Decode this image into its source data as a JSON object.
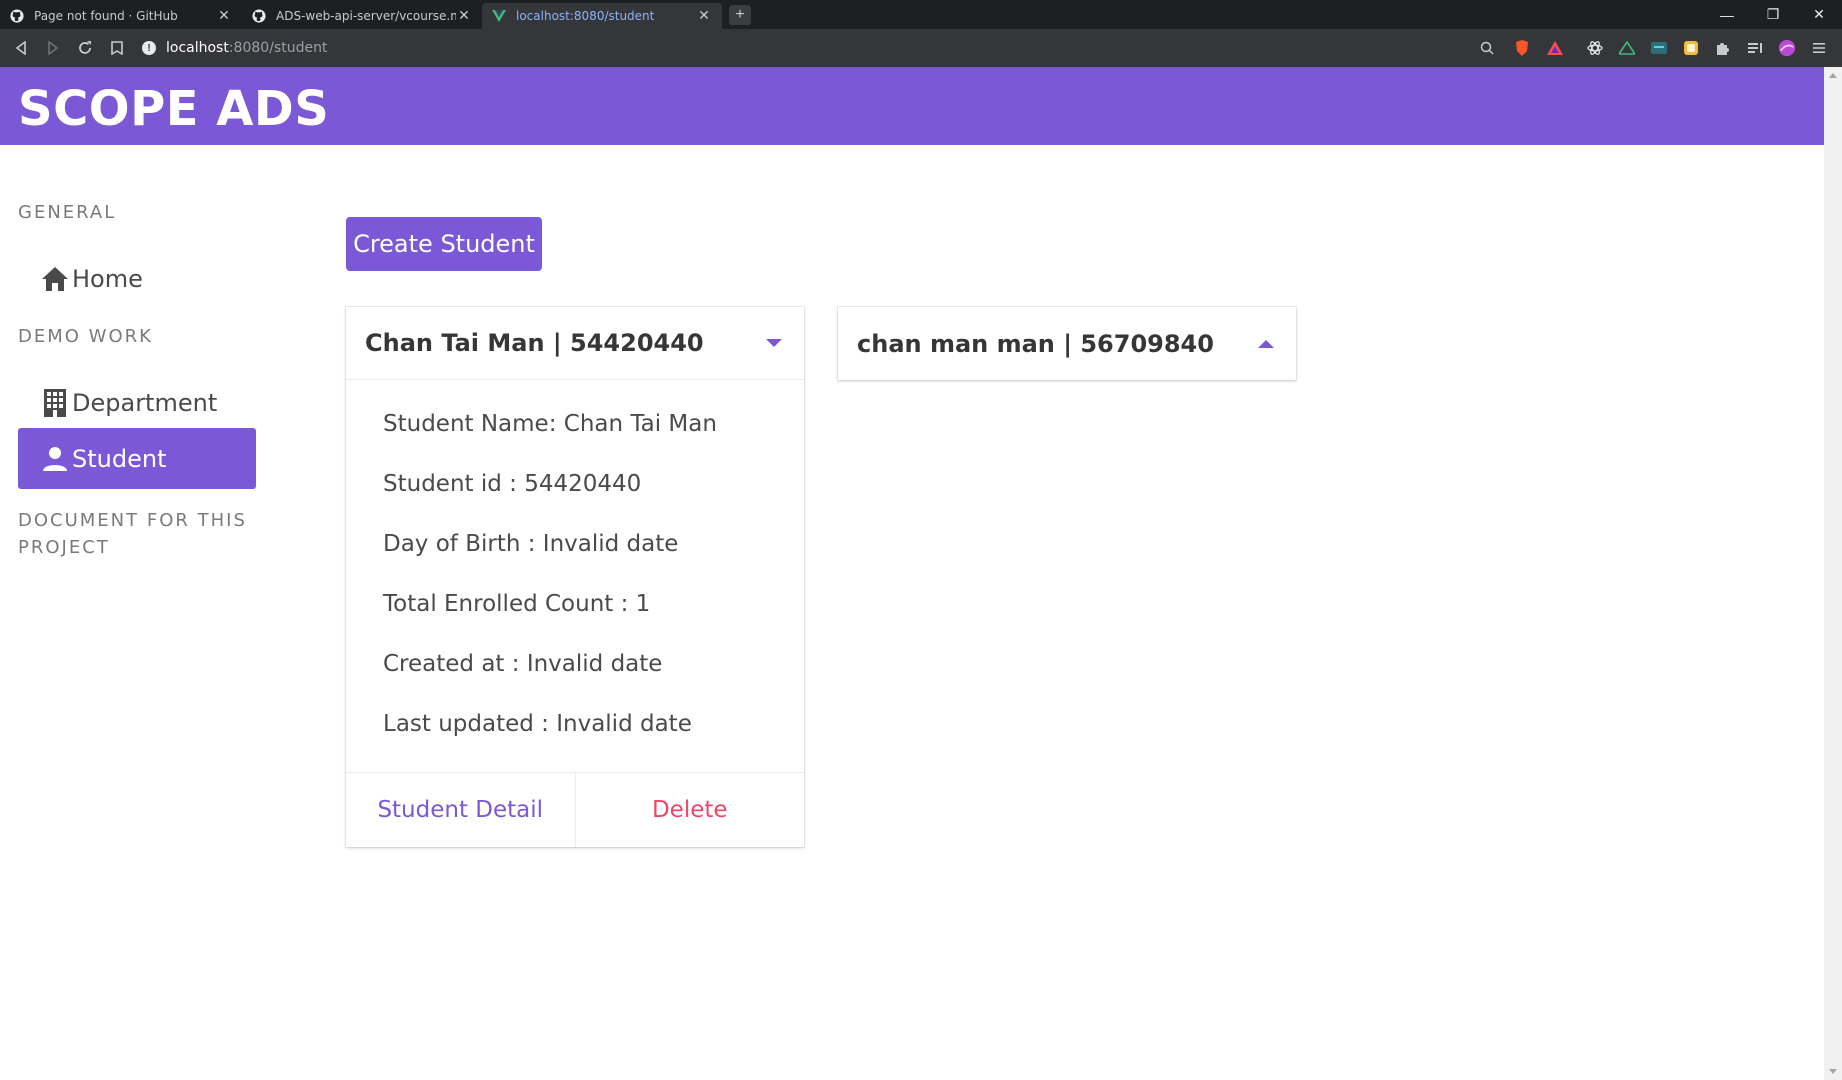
{
  "browser": {
    "tabs": [
      {
        "title": "Page not found · GitHub",
        "active": false
      },
      {
        "title": "ADS-web-api-server/vcourse.md a",
        "active": false
      },
      {
        "title": "localhost:8080/student",
        "active": true
      }
    ],
    "url_host": "localhost",
    "url_path": ":8080/student",
    "close_glyph": "✕",
    "new_tab_glyph": "+",
    "window_controls": {
      "minimize": "—",
      "restore": "❐",
      "close": "✕"
    }
  },
  "app": {
    "title": "SCOPE ADS",
    "accent_color": "#7b58d6",
    "danger_color": "#f14668"
  },
  "sidebar": {
    "general_label": "GENERAL",
    "home_label": "Home",
    "demo_label": "DEMO WORK",
    "department_label": "Department",
    "student_label": "Student",
    "document_label_line1": "DOCUMENT FOR THIS",
    "document_label_line2": "PROJECT"
  },
  "main": {
    "create_button": "Create Student",
    "cards": [
      {
        "header": "Chan Tai Man | 54420440",
        "expanded": true,
        "lines": [
          "Student Name: Chan Tai Man",
          "Student id : 54420440",
          "Day of Birth : Invalid date",
          "Total Enrolled Count : 1",
          "Created at : Invalid date",
          "Last updated : Invalid date"
        ],
        "detail_link": "Student Detail",
        "delete_link": "Delete"
      },
      {
        "header": "chan man man | 56709840",
        "expanded": false
      }
    ]
  }
}
